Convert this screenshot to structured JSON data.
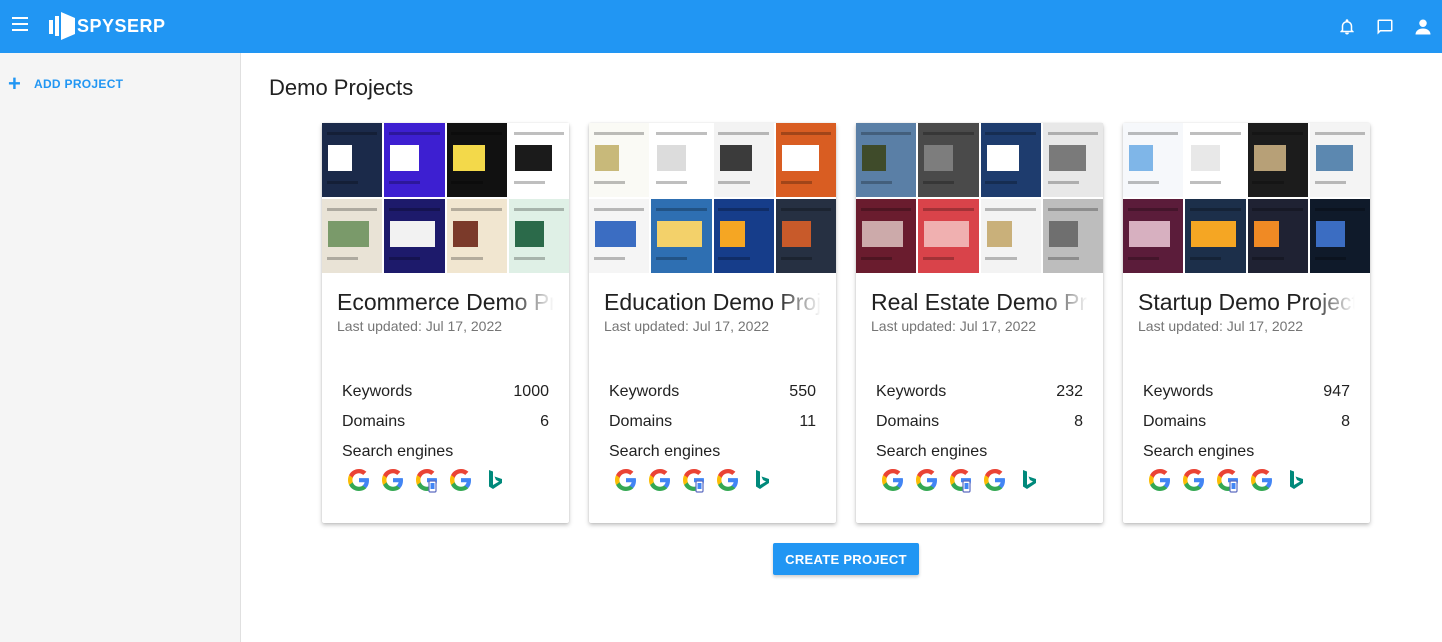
{
  "app": {
    "brand": "SPYSERP",
    "accent_color": "#2196f3"
  },
  "topbar": {
    "icons": [
      "menu-icon",
      "bell-icon",
      "chat-icon",
      "account-icon"
    ]
  },
  "sidebar": {
    "add_project_label": "ADD PROJECT"
  },
  "main": {
    "title": "Demo Projects",
    "create_button_label": "CREATE PROJECT",
    "stat_labels": {
      "keywords": "Keywords",
      "domains": "Domains",
      "search_engines": "Search engines"
    },
    "projects": [
      {
        "name": "Ecommerce Demo Project",
        "updated": "Last updated: Jul 17, 2022",
        "keywords": "1000",
        "domains": "6",
        "engines": [
          "google",
          "google",
          "google-mobile",
          "google",
          "bing"
        ]
      },
      {
        "name": "Education Demo Project",
        "updated": "Last updated: Jul 17, 2022",
        "keywords": "550",
        "domains": "11",
        "engines": [
          "google",
          "google",
          "google-mobile",
          "google",
          "bing"
        ]
      },
      {
        "name": "Real Estate Demo Project",
        "updated": "Last updated: Jul 17, 2022",
        "keywords": "232",
        "domains": "8",
        "engines": [
          "google",
          "google",
          "google-mobile",
          "google",
          "bing"
        ]
      },
      {
        "name": "Startup Demo Project",
        "updated": "Last updated: Jul 17, 2022",
        "keywords": "947",
        "domains": "8",
        "engines": [
          "google",
          "google",
          "google-mobile",
          "google",
          "bing"
        ]
      }
    ]
  }
}
